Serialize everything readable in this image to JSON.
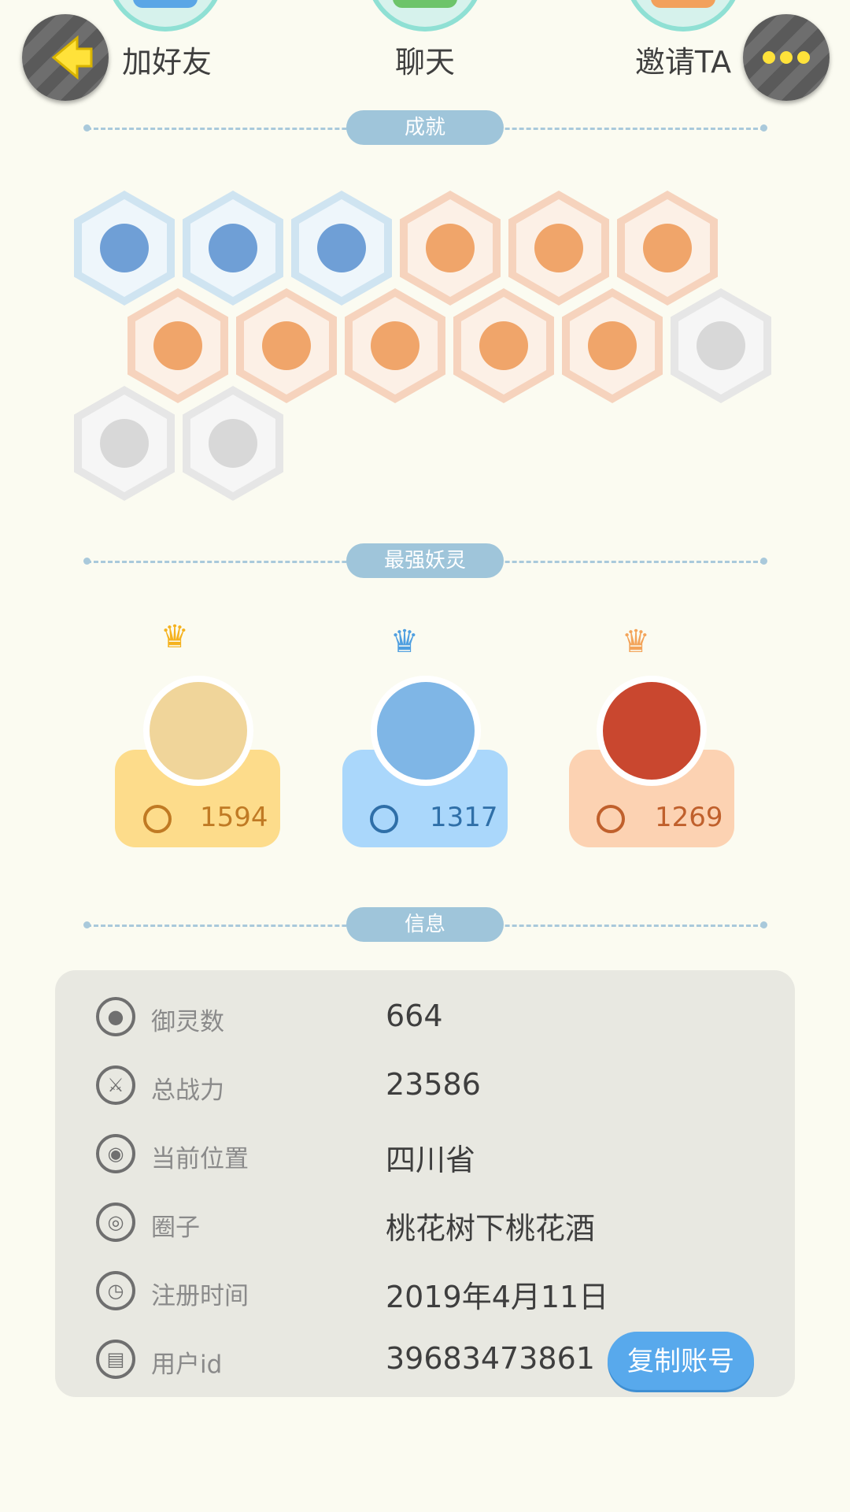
{
  "top_actions": [
    {
      "label": "加好友",
      "icon": "add-friend-icon",
      "color": "#5aa6e6"
    },
    {
      "label": "聊天",
      "icon": "chat-icon",
      "color": "#6dc46a"
    },
    {
      "label": "邀请TA",
      "icon": "invite-icon",
      "color": "#f2a15c"
    }
  ],
  "nav": {
    "back_icon": "back-arrow-icon",
    "more_icon": "more-icon"
  },
  "sections": {
    "achievements": "成就",
    "spirits": "最强妖灵",
    "info": "信息"
  },
  "achievements": [
    {
      "icon": "sneaker-badge-icon",
      "tone": "blue"
    },
    {
      "icon": "cat-face-badge-icon",
      "tone": "blue"
    },
    {
      "icon": "cat-jump-badge-icon",
      "tone": "blue"
    },
    {
      "icon": "target-badge-icon",
      "tone": "orange"
    },
    {
      "icon": "moon-badge-icon",
      "tone": "orange"
    },
    {
      "icon": "orb-badge-icon",
      "tone": "orange"
    },
    {
      "icon": "egg-badge-icon",
      "tone": "orange"
    },
    {
      "icon": "yin-yang-swirl-badge-icon",
      "tone": "orange"
    },
    {
      "icon": "spirit-figure-badge-icon",
      "tone": "orange"
    },
    {
      "icon": "cart-badge-icon",
      "tone": "orange"
    },
    {
      "icon": "yin-yang-box-badge-icon",
      "tone": "orange"
    },
    {
      "icon": "dragon-badge-icon",
      "tone": "grey"
    },
    {
      "icon": "shield-badge-icon",
      "tone": "grey"
    },
    {
      "icon": "fox-book-badge-icon",
      "tone": "grey"
    }
  ],
  "spirits": [
    {
      "power": "1594",
      "crown": "gold-crown-icon",
      "card_color": "#fddc8b",
      "text_color": "#c07a24"
    },
    {
      "power": "1317",
      "crown": "blue-crown-icon",
      "card_color": "#aad7fb",
      "text_color": "#2f6fa8"
    },
    {
      "power": "1269",
      "crown": "orange-crown-icon",
      "card_color": "#fcd2b2",
      "text_color": "#c0602c"
    }
  ],
  "info": {
    "rows": [
      {
        "label": "御灵数",
        "value": "664",
        "icon": "spirit-count-icon"
      },
      {
        "label": "总战力",
        "value": "23586",
        "icon": "sword-icon"
      },
      {
        "label": "当前位置",
        "value": "四川省",
        "icon": "location-pin-icon"
      },
      {
        "label": "圈子",
        "value": "桃花树下桃花酒",
        "icon": "circle-group-icon"
      },
      {
        "label": "注册时间",
        "value": "2019年4月11日",
        "icon": "clock-icon"
      },
      {
        "label": "用户id",
        "value": "39683473861",
        "icon": "id-card-icon"
      }
    ],
    "copy_button": "复制账号"
  }
}
